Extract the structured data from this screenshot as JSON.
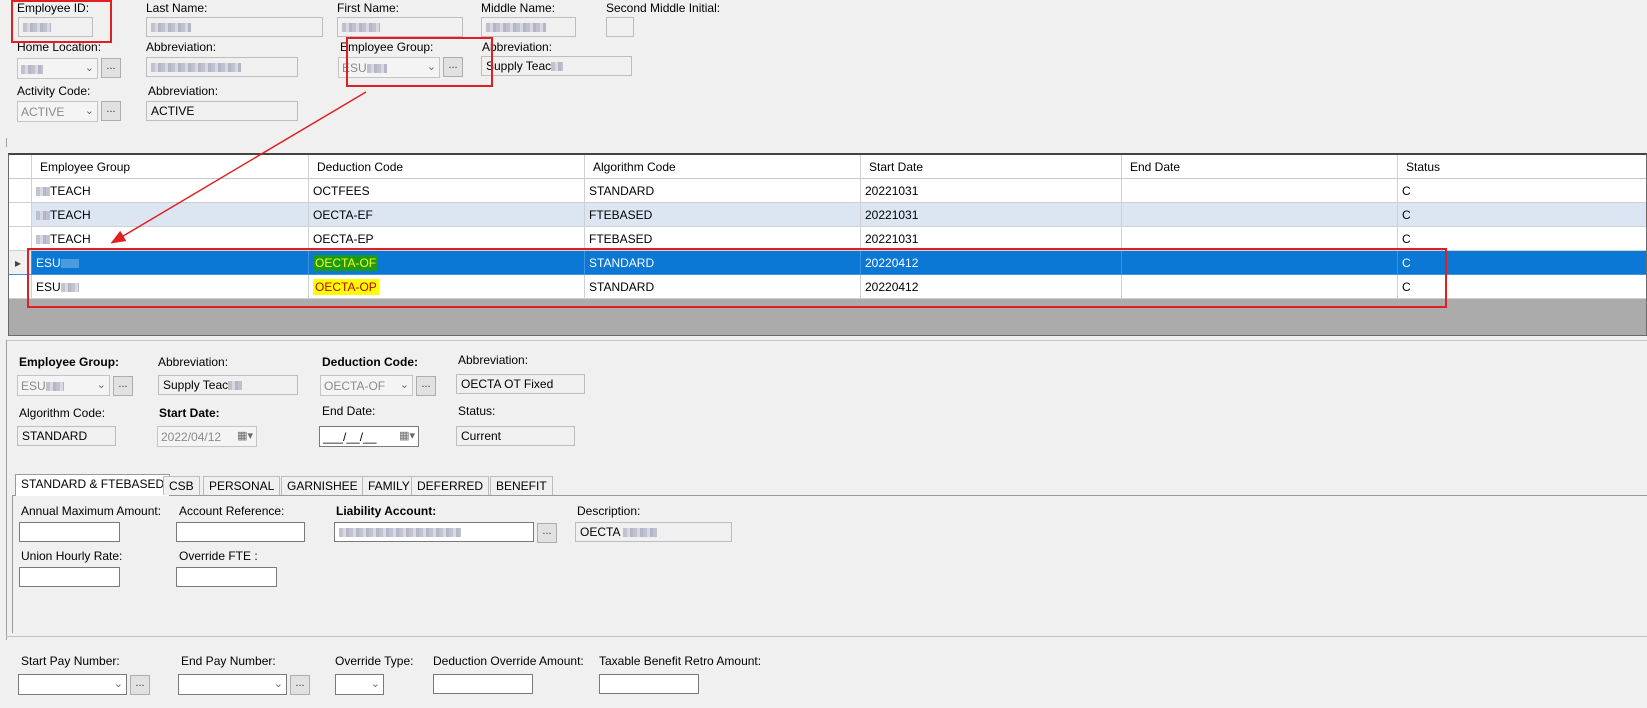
{
  "header": {
    "employee_id_label": "Employee ID:",
    "last_name_label": "Last Name:",
    "first_name_label": "First Name:",
    "middle_name_label": "Middle Name:",
    "second_middle_initial_label": "Second Middle Initial:",
    "home_location_label": "Home Location:",
    "abbreviation_label": "Abbreviation:",
    "employee_group_label": "Employee Group:",
    "employee_group_value": "ESU",
    "group_abbreviation_label": "Abbreviation:",
    "group_abbreviation_value": "Supply Teac",
    "activity_code_label": "Activity Code:",
    "activity_code_value": "ACTIVE",
    "activity_abbreviation_label": "Abbreviation:",
    "activity_abbreviation_value": "ACTIVE",
    "dots": "..."
  },
  "grid": {
    "columns": [
      "Employee Group",
      "Deduction Code",
      "Algorithm Code",
      "Start Date",
      "End Date",
      "Status"
    ],
    "rows": [
      {
        "group": "TEACH",
        "deduction": "OCTFEES",
        "algorithm": "STANDARD",
        "start": "20221031",
        "end": "",
        "status": "C"
      },
      {
        "group": "TEACH",
        "deduction": "OECTA-EF",
        "algorithm": "FTEBASED",
        "start": "20221031",
        "end": "",
        "status": "C"
      },
      {
        "group": "TEACH",
        "deduction": "OECTA-EP",
        "algorithm": "FTEBASED",
        "start": "20221031",
        "end": "",
        "status": "C"
      },
      {
        "group": "ESU",
        "deduction": "OECTA-OF",
        "algorithm": "STANDARD",
        "start": "20220412",
        "end": "",
        "status": "C"
      },
      {
        "group": "ESU",
        "deduction": "OECTA-OP",
        "algorithm": "STANDARD",
        "start": "20220412",
        "end": "",
        "status": "C"
      }
    ],
    "selected_row": 3
  },
  "detail": {
    "employee_group_label": "Employee Group:",
    "employee_group_value": "ESU",
    "abbreviation_label": "Abbreviation:",
    "abbreviation_value": "Supply Teac",
    "deduction_code_label": "Deduction Code:",
    "deduction_code_value": "OECTA-OF",
    "deduction_abbreviation_label": "Abbreviation:",
    "deduction_abbreviation_value": "OECTA OT Fixed",
    "algorithm_code_label": "Algorithm Code:",
    "algorithm_code_value": "STANDARD",
    "start_date_label": "Start Date:",
    "start_date_value": "2022/04/12",
    "end_date_label": "End Date:",
    "end_date_value": "___/__/__",
    "status_label": "Status:",
    "status_value": "Current"
  },
  "tabs": [
    "STANDARD & FTEBASED",
    "CSB",
    "PERSONAL",
    "GARNISHEE",
    "FAMILY",
    "DEFERRED",
    "BENEFIT"
  ],
  "tab_panel": {
    "annual_max_label": "Annual Maximum Amount:",
    "account_reference_label": "Account Reference:",
    "liability_account_label": "Liability Account:",
    "description_label": "Description:",
    "description_value": "OECTA",
    "union_hourly_rate_label": "Union Hourly Rate:",
    "override_fte_label": "Override FTE :"
  },
  "footer": {
    "start_pay_number_label": "Start Pay Number:",
    "end_pay_number_label": "End Pay Number:",
    "override_type_label": "Override Type:",
    "deduction_override_amount_label": "Deduction Override Amount:",
    "taxable_benefit_retro_label": "Taxable Benefit Retro Amount:"
  },
  "colors": {
    "selection": "#0a78d4",
    "alt_row": "#dce6f2",
    "annotation_red": "#e02020",
    "highlight_green": "#1c9a1c",
    "highlight_yellow": "#ffff00"
  }
}
